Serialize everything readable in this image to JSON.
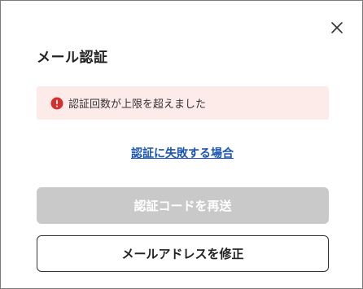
{
  "dialog": {
    "title": "メール認証",
    "close_icon": "close-icon"
  },
  "alert": {
    "icon": "exclamation-circle-icon",
    "message": "認証回数が上限を超えました",
    "color": "#d32f2f",
    "background": "#fcebe9"
  },
  "links": {
    "auth_failed": "認証に失敗する場合"
  },
  "buttons": {
    "resend_label": "認証コードを再送",
    "edit_email_label": "メールアドレスを修正"
  }
}
